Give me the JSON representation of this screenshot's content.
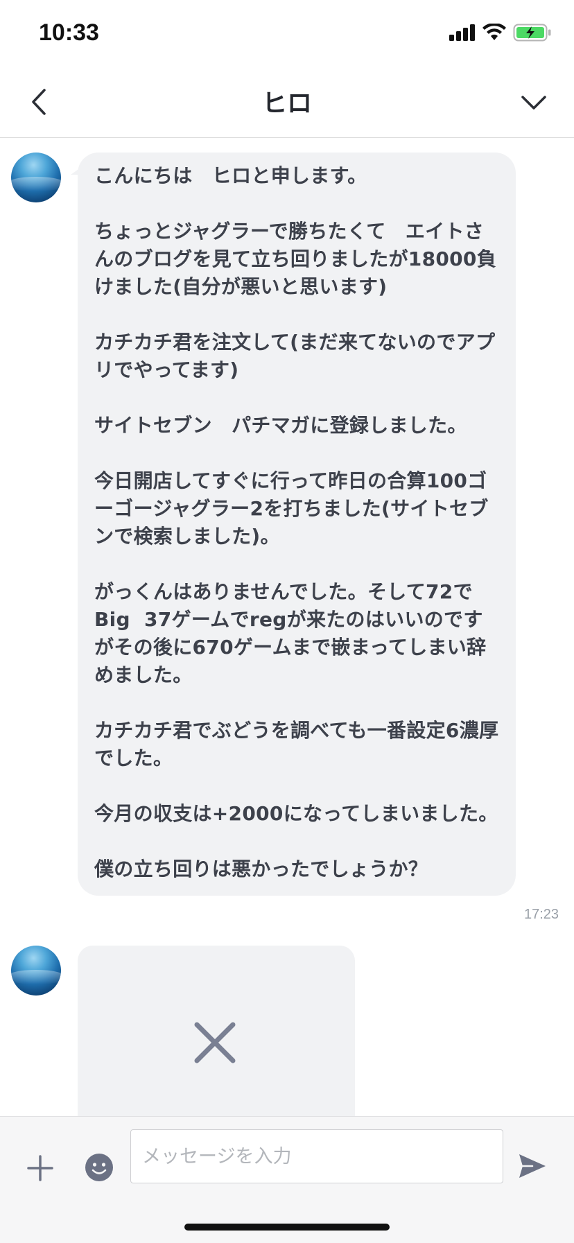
{
  "status_bar": {
    "time": "10:33",
    "icons": [
      "cellular-signal-icon",
      "wifi-icon",
      "battery-charging-icon"
    ],
    "battery_color": "#4cd964"
  },
  "header": {
    "title": "ヒロ",
    "back_icon": "chevron-left-icon",
    "menu_icon": "chevron-down-icon"
  },
  "messages": [
    {
      "sender": "ヒロ",
      "text": "こんにちは　ヒロと申します。\n\nちょっとジャグラーで勝ちたくて　エイトさんのブログを見て立ち回りましたが18000負けました(自分が悪いと思います)\n\nカチカチ君を注文して(まだ来てないのでアプリでやってます)\n\nサイトセブン　パチマガに登録しました。\n\n今日開店してすぐに行って昨日の合算100ゴーゴージャグラー2を打ちました(サイトセブンで検索しました)。\n\nがっくんはありませんでした。そして72でBig  37ゲームでregが来たのはいいのですがその後に670ゲームまで嵌まってしまい辞めました。\n\nカチカチ君でぶどうを調べても一番設定6濃厚でした。\n\n今月の収支は+2000になってしまいました。\n\n僕の立ち回りは悪かったでしょうか？",
      "time": "17:23"
    },
    {
      "sender": "ヒロ",
      "type": "image",
      "status_icon": "broken-image-x-icon"
    }
  ],
  "composer": {
    "placeholder": "メッセージを入力",
    "value": "",
    "plus_icon": "plus-icon",
    "emoji_icon": "emoji-icon",
    "send_icon": "send-icon"
  },
  "colors": {
    "bubble_bg": "#f1f2f4",
    "text": "#3d414b",
    "icon": "#6b7184"
  }
}
